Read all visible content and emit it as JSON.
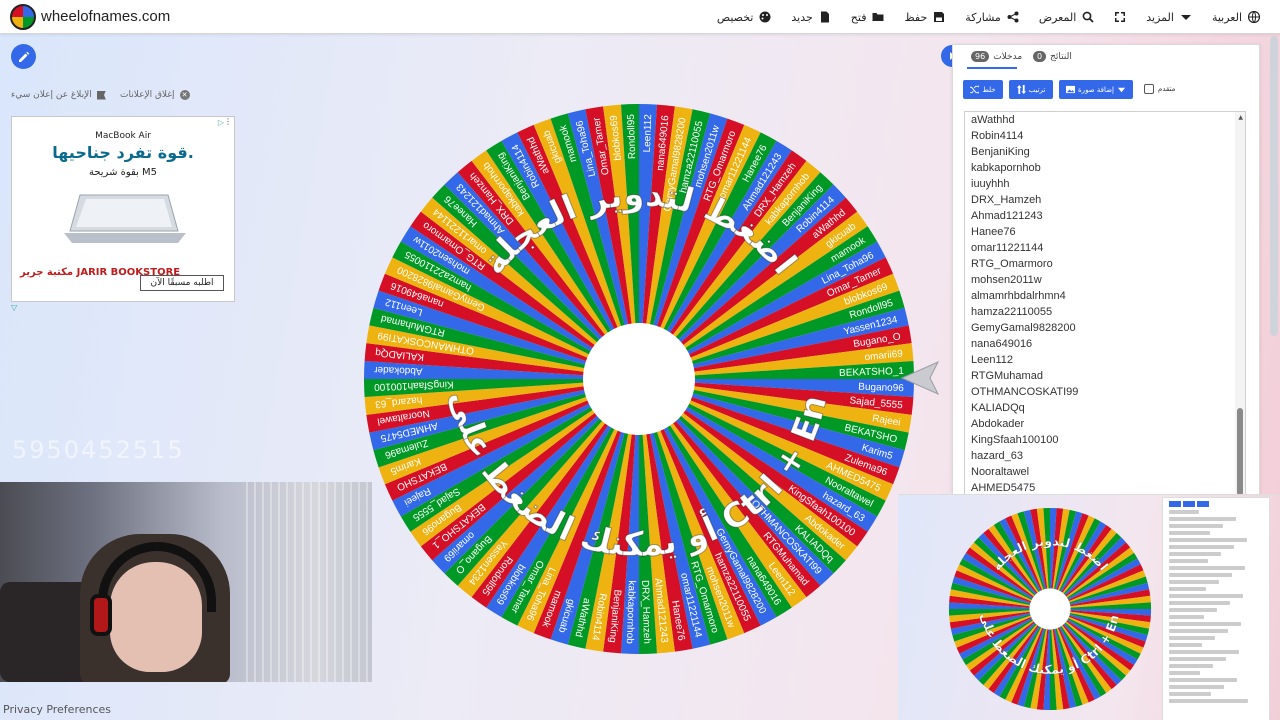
{
  "site": {
    "title": "wheelofnames.com"
  },
  "menu": [
    {
      "label": "العربية",
      "icon": "globe-icon"
    },
    {
      "label": "المزيد",
      "icon": "caret-down-icon"
    },
    {
      "label": "",
      "icon": "fullscreen-icon"
    },
    {
      "label": "المعرض",
      "icon": "search-icon"
    },
    {
      "label": "مشاركة",
      "icon": "share-icon"
    },
    {
      "label": "حفظ",
      "icon": "save-icon"
    },
    {
      "label": "فتح",
      "icon": "folder-icon"
    },
    {
      "label": "جديد",
      "icon": "new-file-icon"
    },
    {
      "label": "تخصيص",
      "icon": "palette-icon"
    }
  ],
  "ads": {
    "report_label": "الإبلاغ عن إعلان سيء",
    "close_label": "إغلاق الإعلانات",
    "brand": "MacBook Air",
    "headline": "قوة تفرد جناحيها.",
    "sub": "بقوة شريحة M5",
    "store": "مكتبة جرير JARIR BOOKSTORE",
    "cta": "اطلبه مسبقًا الآن"
  },
  "faint_text": "5950452515",
  "privacy_label": "Privacy Preferences",
  "wheel": {
    "line1": "اضغط لتدوير العجلة",
    "line2": "أو يمكنك الضغط على زر",
    "line3": "Ctrl + Enter",
    "colors": [
      "#3369e8",
      "#d50f25",
      "#eeb211",
      "#009925"
    ],
    "visible_names": [
      "Leen112",
      "nana649016",
      "GemyGamal9828200",
      "hamza22110055",
      "mohsen2011w",
      "RTG_Omarmoro",
      "omar11221144",
      "Hanee76",
      "Ahmad121243",
      "DRX_Hamzeh",
      "kabkapornhob",
      "BenjaniKing",
      "Robin4114",
      "aWathhd",
      "gkicuab",
      "mamook",
      "Lina_Toha96",
      "Omar_Tamer",
      "blobkos69",
      "Rondoll95",
      "Yassen1234",
      "Bugano_O",
      "omarii69",
      "BEKATSHO_1",
      "Bugano96",
      "Sajad_5555",
      "Rajeei",
      "BEKATSHO",
      "Karim5",
      "Zulema96",
      "AHMED5475",
      "Nooraltawel",
      "hazard_63",
      "KingSfaah100100",
      "Abdokader",
      "KALIADQq",
      "OTHMANCOSKATI99",
      "RTGMuhamad"
    ]
  },
  "panel": {
    "tab_entries": "مدخلات",
    "tab_entries_count": "96",
    "tab_results": "النتائج",
    "tab_results_count": "0",
    "shuffle_label": "خلط",
    "sort_label": "ترتيب",
    "add_image_label": "إضافة صورة",
    "advanced_label": "متقدم",
    "entries": [
      "aWathhd",
      "Robin4114",
      "BenjaniKing",
      "kabkapornhob",
      "iuuyhhh",
      "DRX_Hamzeh",
      "Ahmad121243",
      "Hanee76",
      "omar11221144",
      "RTG_Omarmoro",
      "mohsen2011w",
      "almamrhbdalrhmn4",
      "hamza22110055",
      "GemyGamal9828200",
      "nana649016",
      "Leen112",
      "RTGMuhamad",
      "OTHMANCOSKATI99",
      "KALIADQq",
      "Abdokader",
      "KingSfaah100100",
      "hazard_63",
      "Nooraltawel",
      "AHMED5475"
    ]
  }
}
